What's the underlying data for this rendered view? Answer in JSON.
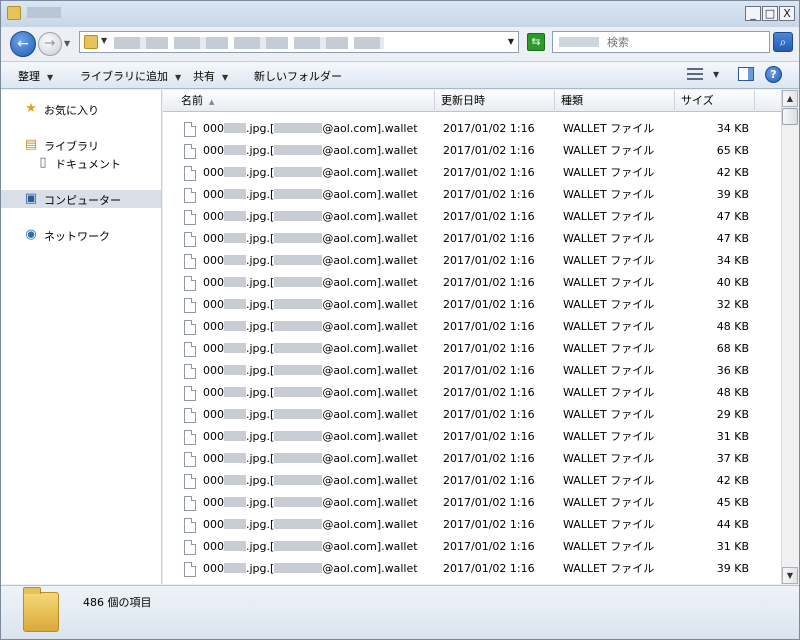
{
  "window": {
    "title": "",
    "minimize_glyph": "_",
    "maximize_glyph": "□",
    "close_glyph": "X"
  },
  "address": {
    "back_glyph": "←",
    "forward_glyph": "→",
    "search_placeholder": "検索",
    "search_glyph": "⌕",
    "refresh_glyph": "⇆"
  },
  "commands": {
    "organize": "整理",
    "include_in_library": "ライブラリに追加",
    "share": "共有",
    "new_folder": "新しいフォルダー",
    "help": "?"
  },
  "nav": {
    "favorites": "お気に入り",
    "libraries": "ライブラリ",
    "documents": "ドキュメント",
    "computer": "コンピューター",
    "network": "ネットワーク"
  },
  "columns": {
    "name": "名前",
    "modified": "更新日時",
    "type": "種類",
    "size": "サイズ"
  },
  "file_prefix": "000",
  "file_mid": ".jpg.[",
  "file_suffix": "@aol.com].wallet",
  "files": [
    {
      "date": "2017/01/02 1:16",
      "type": "WALLET ファイル",
      "size": "34 KB"
    },
    {
      "date": "2017/01/02 1:16",
      "type": "WALLET ファイル",
      "size": "65 KB"
    },
    {
      "date": "2017/01/02 1:16",
      "type": "WALLET ファイル",
      "size": "42 KB"
    },
    {
      "date": "2017/01/02 1:16",
      "type": "WALLET ファイル",
      "size": "39 KB"
    },
    {
      "date": "2017/01/02 1:16",
      "type": "WALLET ファイル",
      "size": "47 KB"
    },
    {
      "date": "2017/01/02 1:16",
      "type": "WALLET ファイル",
      "size": "47 KB"
    },
    {
      "date": "2017/01/02 1:16",
      "type": "WALLET ファイル",
      "size": "34 KB"
    },
    {
      "date": "2017/01/02 1:16",
      "type": "WALLET ファイル",
      "size": "40 KB"
    },
    {
      "date": "2017/01/02 1:16",
      "type": "WALLET ファイル",
      "size": "32 KB"
    },
    {
      "date": "2017/01/02 1:16",
      "type": "WALLET ファイル",
      "size": "48 KB"
    },
    {
      "date": "2017/01/02 1:16",
      "type": "WALLET ファイル",
      "size": "68 KB"
    },
    {
      "date": "2017/01/02 1:16",
      "type": "WALLET ファイル",
      "size": "36 KB"
    },
    {
      "date": "2017/01/02 1:16",
      "type": "WALLET ファイル",
      "size": "48 KB"
    },
    {
      "date": "2017/01/02 1:16",
      "type": "WALLET ファイル",
      "size": "29 KB"
    },
    {
      "date": "2017/01/02 1:16",
      "type": "WALLET ファイル",
      "size": "31 KB"
    },
    {
      "date": "2017/01/02 1:16",
      "type": "WALLET ファイル",
      "size": "37 KB"
    },
    {
      "date": "2017/01/02 1:16",
      "type": "WALLET ファイル",
      "size": "42 KB"
    },
    {
      "date": "2017/01/02 1:16",
      "type": "WALLET ファイル",
      "size": "45 KB"
    },
    {
      "date": "2017/01/02 1:16",
      "type": "WALLET ファイル",
      "size": "44 KB"
    },
    {
      "date": "2017/01/02 1:16",
      "type": "WALLET ファイル",
      "size": "31 KB"
    },
    {
      "date": "2017/01/02 1:16",
      "type": "WALLET ファイル",
      "size": "39 KB"
    }
  ],
  "status": {
    "item_count": "486 個の項目"
  }
}
